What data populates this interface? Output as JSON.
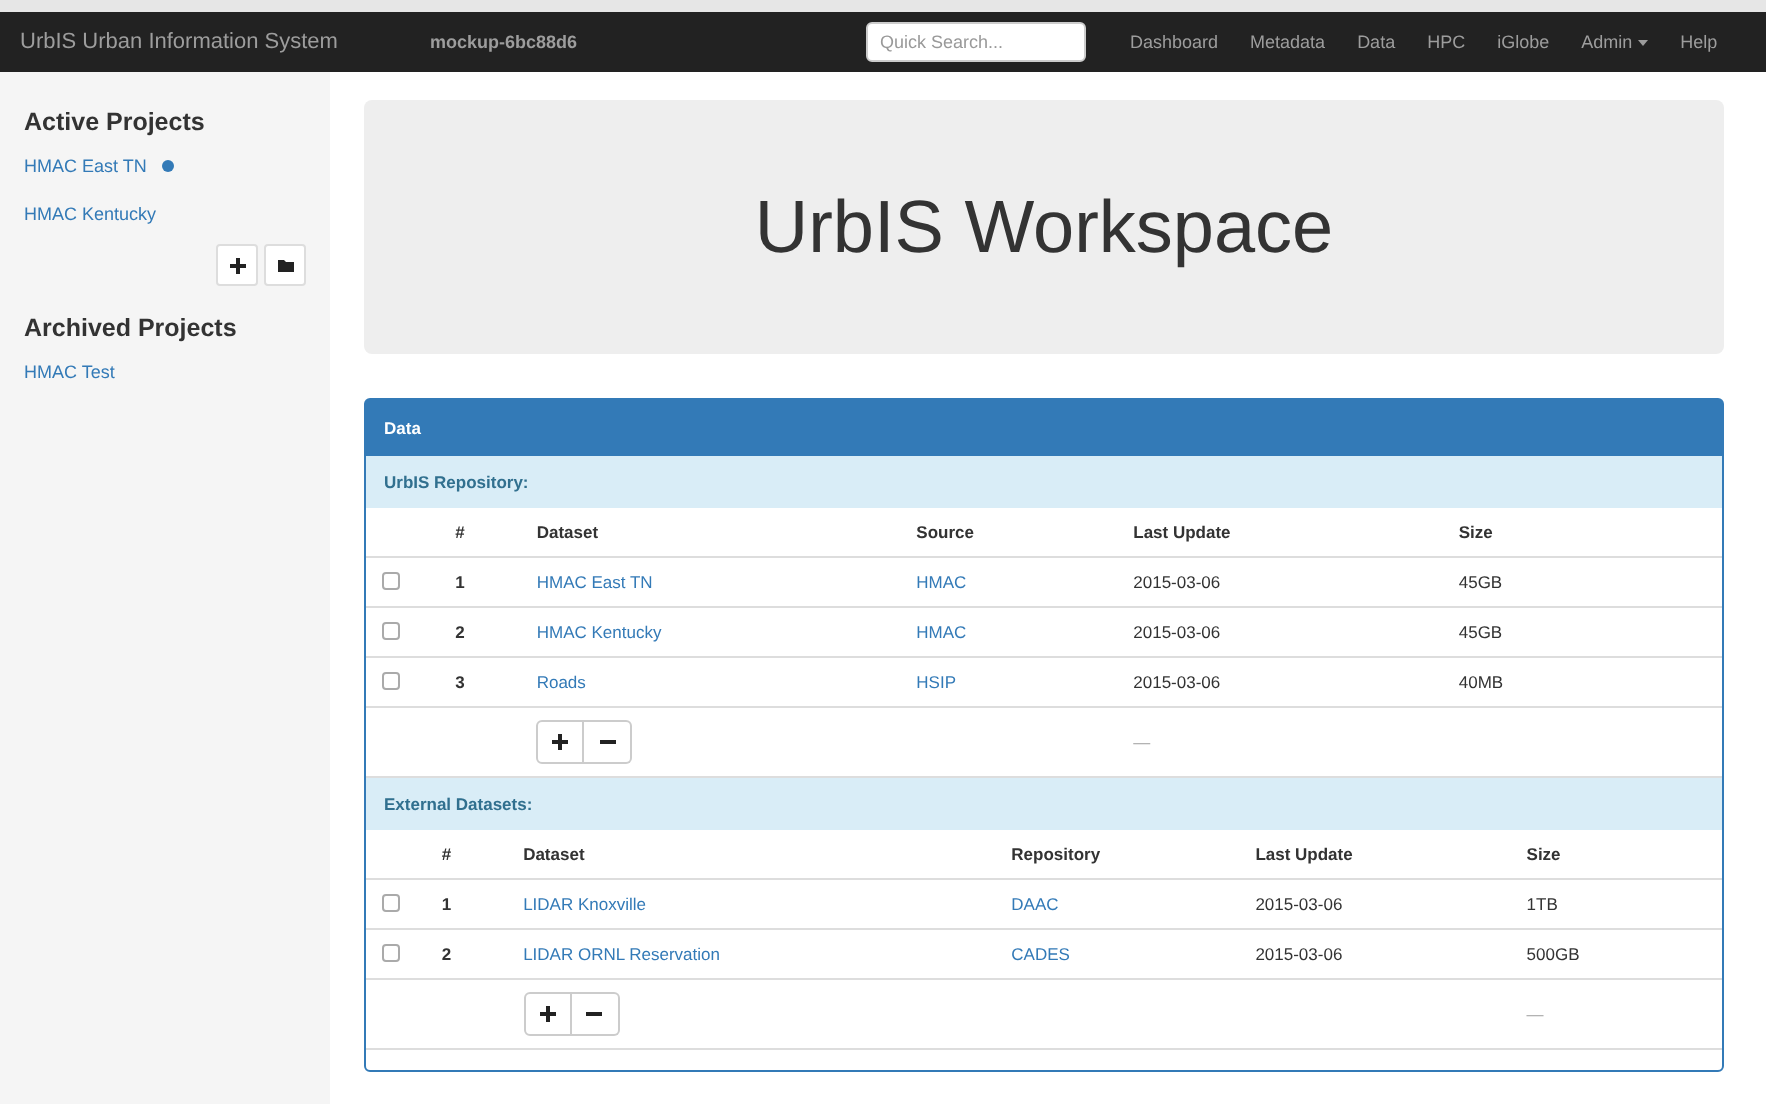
{
  "navbar": {
    "brand": "UrbIS Urban Information System",
    "build": "mockup-6bc88d6",
    "search": {
      "placeholder": "Quick Search..."
    },
    "links": [
      {
        "label": "Dashboard",
        "kind": "link"
      },
      {
        "label": "Metadata",
        "kind": "link"
      },
      {
        "label": "Data",
        "kind": "link"
      },
      {
        "label": "HPC",
        "kind": "link"
      },
      {
        "label": "iGlobe",
        "kind": "link"
      },
      {
        "label": "Admin",
        "kind": "dropdown"
      },
      {
        "label": "Help",
        "kind": "link"
      }
    ]
  },
  "sidebar": {
    "sections": [
      {
        "title": "Active Projects",
        "projects": [
          {
            "name": "HMAC East TN",
            "selected": true
          },
          {
            "name": "HMAC Kentucky",
            "selected": false
          }
        ],
        "tools": true
      },
      {
        "title": "Archived Projects",
        "projects": [
          {
            "name": "HMAC Test",
            "selected": false
          }
        ],
        "tools": false
      }
    ]
  },
  "jumbotron": {
    "title": "UrbIS Workspace"
  },
  "panel": {
    "title": "Data",
    "groups": [
      {
        "title": "UrbIS Repository:",
        "columns": [
          "#",
          "Dataset",
          "Source",
          "Last Update",
          "Size"
        ],
        "rows": [
          {
            "checked": false,
            "cells": [
              "1",
              "HMAC East TN",
              "HMAC",
              "2015-03-06",
              "45GB"
            ]
          },
          {
            "checked": false,
            "cells": [
              "2",
              "HMAC Kentucky",
              "HMAC",
              "2015-03-06",
              "45GB"
            ]
          },
          {
            "checked": false,
            "cells": [
              "3",
              "Roads",
              "HSIP",
              "2015-03-06",
              "40MB"
            ]
          }
        ],
        "footer_note": "—"
      },
      {
        "title": "External Datasets:",
        "columns": [
          "#",
          "Dataset",
          "Repository",
          "Last Update",
          "Size"
        ],
        "rows": [
          {
            "checked": false,
            "cells": [
              "1",
              "LIDAR Knoxville",
              "DAAC",
              "2015-03-06",
              "1TB"
            ]
          },
          {
            "checked": false,
            "cells": [
              "2",
              "LIDAR ORNL Reservation",
              "CADES",
              "2015-03-06",
              "500GB"
            ]
          }
        ],
        "footer_note": "—"
      }
    ]
  }
}
